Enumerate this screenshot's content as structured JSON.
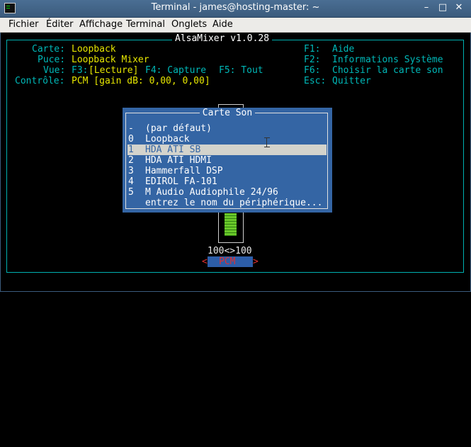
{
  "window": {
    "title": "Terminal - james@hosting-master: ~",
    "minimize": "–",
    "maximize": "□",
    "close": "✕"
  },
  "menu": [
    "Fichier",
    "Éditer",
    "Affichage",
    "Terminal",
    "Onglets",
    "Aide"
  ],
  "mixer": {
    "title": "AlsaMixer v1.0.28",
    "info": {
      "card_label": "Carte:",
      "card_value": "Loopback",
      "chip_label": "Puce:",
      "chip_value": "Loopback Mixer",
      "view_label": "Vue:",
      "view_f3": "F3:",
      "view_active": "[Lecture]",
      "view_f4": "F4: Capture",
      "view_f5": "F5: Tout",
      "control_label": "Contrôle:",
      "control_value": "PCM [gain dB: 0,00, 0,00]"
    },
    "keys": [
      {
        "key": "F1:",
        "action": "Aide"
      },
      {
        "key": "F2:",
        "action": "Informations Système"
      },
      {
        "key": "F6:",
        "action": "Choisir la carte son"
      },
      {
        "key": "Esc:",
        "action": "Quitter"
      }
    ],
    "volume_readout": "100<>100",
    "volume_level": 1.0,
    "channel": {
      "left_arrow": "<",
      "name": "PCM",
      "right_arrow": ">"
    }
  },
  "dialog": {
    "title": "Carte Son",
    "items": [
      {
        "index": "-",
        "label": "(par défaut)"
      },
      {
        "index": "0",
        "label": "Loopback"
      },
      {
        "index": "1",
        "label": "HDA ATI SB"
      },
      {
        "index": "2",
        "label": "HDA ATI HDMI"
      },
      {
        "index": "3",
        "label": "Hammerfall DSP"
      },
      {
        "index": "4",
        "label": "EDIROL FA-101"
      },
      {
        "index": "5",
        "label": "M Audio Audiophile 24/96"
      },
      {
        "index": "",
        "label": "entrez le nom du périphérique..."
      }
    ],
    "selected_index": 2
  },
  "colors": {
    "titlebar": "#3b5b7d",
    "dialog_bg": "#3465a4",
    "highlight": "#d3d3cc",
    "label_cyan": "#00b8b8",
    "value_yellow": "#e6e600"
  }
}
